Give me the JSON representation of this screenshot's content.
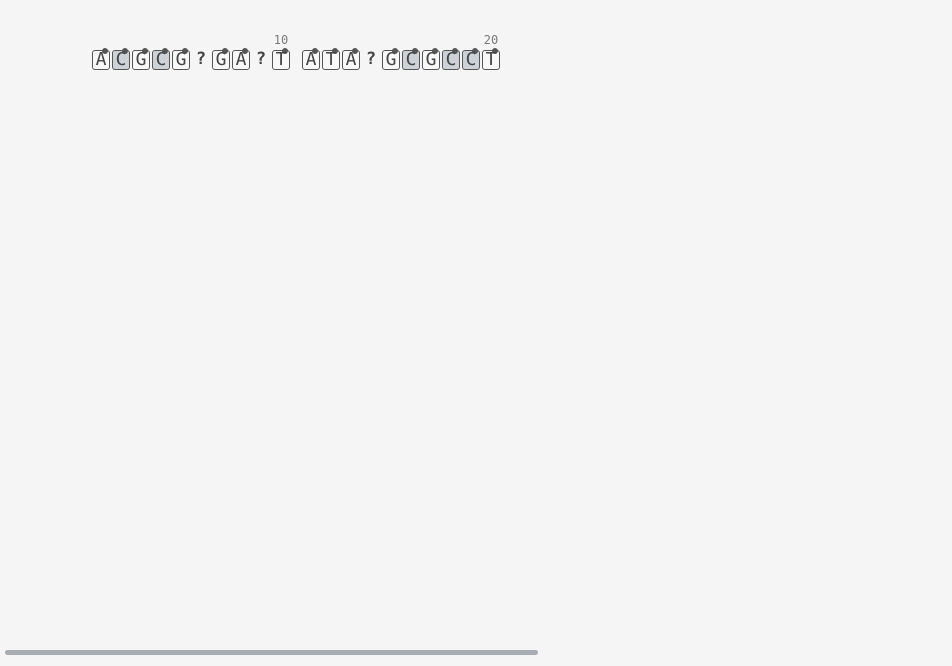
{
  "sequence": {
    "bases": [
      {
        "letter": "A",
        "boxed": true,
        "shaded": false
      },
      {
        "letter": "C",
        "boxed": true,
        "shaded": true
      },
      {
        "letter": "G",
        "boxed": true,
        "shaded": false
      },
      {
        "letter": "C",
        "boxed": true,
        "shaded": true
      },
      {
        "letter": "G",
        "boxed": true,
        "shaded": false
      },
      {
        "letter": "?",
        "boxed": false,
        "shaded": false
      },
      {
        "letter": "G",
        "boxed": true,
        "shaded": false
      },
      {
        "letter": "A",
        "boxed": true,
        "shaded": false
      },
      {
        "letter": "?",
        "boxed": false,
        "shaded": false
      },
      {
        "letter": "T",
        "boxed": true,
        "shaded": false
      },
      {
        "letter": "A",
        "boxed": true,
        "shaded": false
      },
      {
        "letter": "T",
        "boxed": true,
        "shaded": false
      },
      {
        "letter": "A",
        "boxed": true,
        "shaded": false
      },
      {
        "letter": "?",
        "boxed": false,
        "shaded": false
      },
      {
        "letter": "G",
        "boxed": true,
        "shaded": false
      },
      {
        "letter": "C",
        "boxed": true,
        "shaded": true
      },
      {
        "letter": "G",
        "boxed": true,
        "shaded": false
      },
      {
        "letter": "C",
        "boxed": true,
        "shaded": true
      },
      {
        "letter": "C",
        "boxed": true,
        "shaded": true
      },
      {
        "letter": "T",
        "boxed": true,
        "shaded": false
      }
    ],
    "ruler_labels": [
      "10",
      "20"
    ]
  },
  "scrollbar": {
    "thumb_fraction": 0.56
  },
  "colors": {
    "background": "#f5f5f5",
    "base_border": "#555555",
    "base_shaded": "#cdd2d8",
    "scroll_thumb": "#a8adb3"
  }
}
